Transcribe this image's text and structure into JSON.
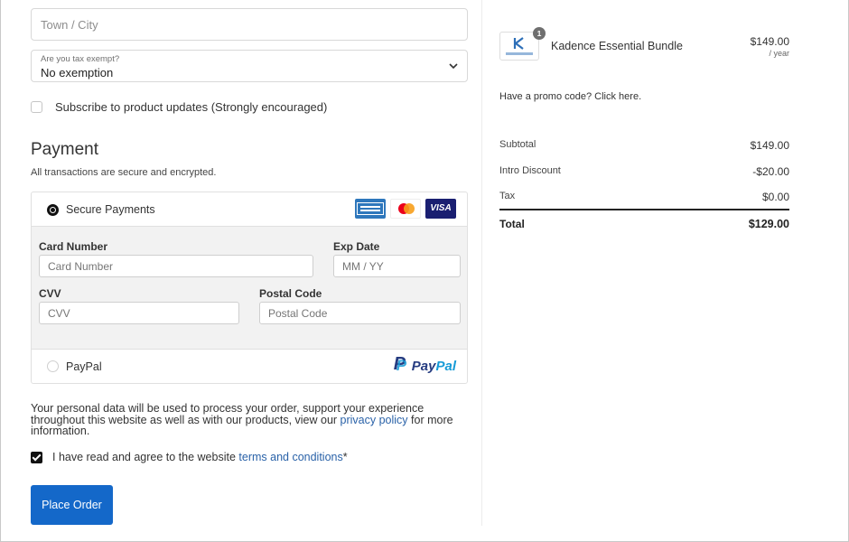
{
  "billing": {
    "town_placeholder": "Town / City",
    "tax_label": "Are you tax exempt?",
    "tax_value": "No exemption"
  },
  "subscribe": {
    "label": "Subscribe to product updates (Strongly encouraged)",
    "checked": false
  },
  "payment": {
    "title": "Payment",
    "subtitle": "All transactions are secure and encrypted.",
    "option_secure": "Secure Payments",
    "card_brands": [
      "amex",
      "mastercard",
      "visa"
    ],
    "visa_text": "VISA",
    "card_number_label": "Card Number",
    "card_number_placeholder": "Card Number",
    "exp_label": "Exp Date",
    "exp_placeholder": "MM / YY",
    "cvv_label": "CVV",
    "cvv_placeholder": "CVV",
    "postal_label": "Postal Code",
    "postal_placeholder": "Postal Code",
    "option_paypal": "PayPal",
    "paypal_logo_a": "Pay",
    "paypal_logo_b": "Pal"
  },
  "privacy": {
    "text_before": "Your personal data will be used to process your order, support your experience throughout this website as well as with our products, view our ",
    "link": "privacy policy",
    "text_after": " for more information."
  },
  "terms": {
    "text": "I have read and agree to the website ",
    "link": "terms and conditions",
    "suffix": "*",
    "checked": true
  },
  "place_order": "Place Order",
  "order": {
    "product_name": "Kadence Essential Bundle",
    "quantity": "1",
    "price": "$149.00",
    "per": "/ year",
    "promo": "Have a promo code? Click here.",
    "subtotal_label": "Subtotal",
    "subtotal": "$149.00",
    "discount_label": "Intro Discount",
    "discount": "-$20.00",
    "tax_label": "Tax",
    "tax": "$0.00",
    "total_label": "Total",
    "total": "$129.00"
  },
  "colors": {
    "primary_button": "#1468c9",
    "link": "#2a62a8",
    "paypal_dark": "#253b80",
    "paypal_light": "#179bd7"
  }
}
